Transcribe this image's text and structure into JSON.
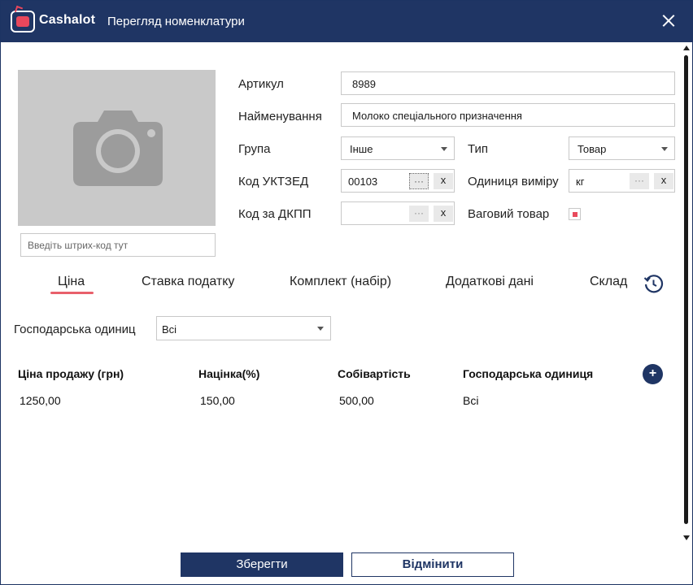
{
  "titlebar": {
    "logo_text": "Cashalot",
    "title": "Перегляд номенклатури"
  },
  "photo": {
    "barcode_placeholder": "Введіть штрих-код тут"
  },
  "form": {
    "article_label": "Артикул",
    "article_value": "8989",
    "name_label": "Найменування",
    "name_value": "Молоко спеціального призначення",
    "group_label": "Група",
    "group_value": "Інше",
    "type_label": "Тип",
    "type_value": "Товар",
    "uktzed_label": "Код УКТЗЕД",
    "uktzed_value": "00103",
    "unit_label": "Одиниця виміру",
    "unit_value": "кг",
    "dkpp_label": "Код за ДКПП",
    "dkpp_value": "",
    "weight_label": "Ваговий товар",
    "weight_checked": true,
    "dots": "···",
    "clear": "x"
  },
  "tabs": [
    {
      "label": "Ціна",
      "active": true
    },
    {
      "label": "Ставка податку",
      "active": false
    },
    {
      "label": "Комплект (набір)",
      "active": false
    },
    {
      "label": "Додаткові дані",
      "active": false
    },
    {
      "label": "Склад",
      "active": false
    }
  ],
  "filter": {
    "label": "Господарська одиниц",
    "value": "Всі"
  },
  "price_table": {
    "headers": [
      "Ціна продажу (грн)",
      "Націнка(%)",
      "Собівартість",
      "Господарська одиниця"
    ],
    "rows": [
      [
        "1250,00",
        "150,00",
        "500,00",
        "Всі"
      ]
    ],
    "add_label": "+"
  },
  "footer": {
    "save_label": "Зберегти",
    "cancel_label": "Відмінити"
  },
  "colors": {
    "brand": "#1f3564",
    "accent": "#e8475c"
  }
}
